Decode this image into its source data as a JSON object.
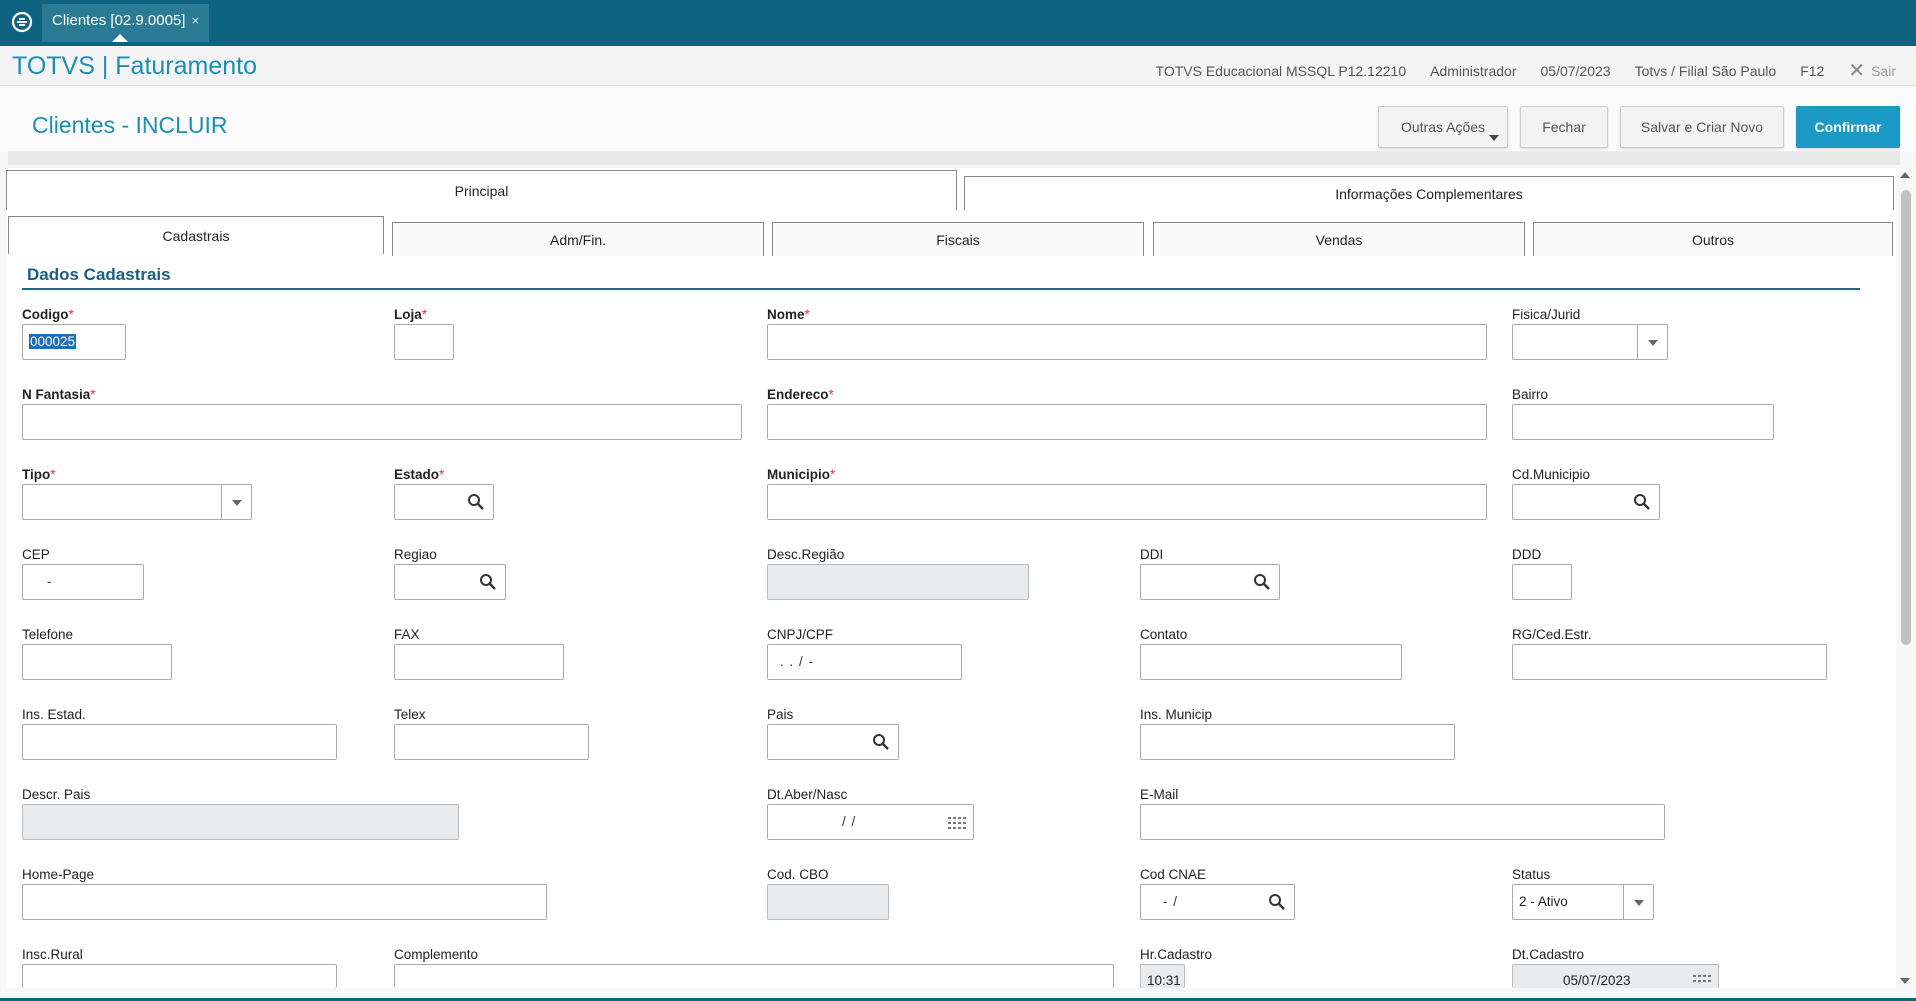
{
  "window": {
    "tab_label": "Clientes [02.9.0005]",
    "tab_close": "×"
  },
  "app": {
    "title": "TOTVS | Faturamento",
    "environment": "TOTVS Educacional MSSQL P12.12210",
    "user": "Administrador",
    "date": "05/07/2023",
    "branch": "Totvs / Filial São Paulo",
    "help_key": "F12",
    "exit_label": "Sair"
  },
  "page": {
    "title": "Clientes - INCLUIR",
    "buttons": {
      "outras_acoes": "Outras Ações",
      "fechar": "Fechar",
      "salvar_criar_novo": "Salvar e Criar Novo",
      "confirmar": "Confirmar"
    }
  },
  "folders": [
    "Principal",
    "Informações Complementares"
  ],
  "subtabs": [
    "Cadastrais",
    "Adm/Fin.",
    "Fiscais",
    "Vendas",
    "Outros"
  ],
  "section_title": "Dados Cadastrais",
  "fields": {
    "codigo": {
      "label": "Codigo",
      "value": "000025"
    },
    "loja": {
      "label": "Loja",
      "value": ""
    },
    "nome": {
      "label": "Nome",
      "value": ""
    },
    "fisica_jurid": {
      "label": "Fisica/Jurid",
      "value": ""
    },
    "n_fantasia": {
      "label": "N Fantasia",
      "value": ""
    },
    "endereco": {
      "label": "Endereco",
      "value": ""
    },
    "bairro": {
      "label": "Bairro",
      "value": ""
    },
    "tipo": {
      "label": "Tipo",
      "value": ""
    },
    "estado": {
      "label": "Estado",
      "value": ""
    },
    "municipio": {
      "label": "Municipio",
      "value": ""
    },
    "cd_municipio": {
      "label": "Cd.Municipio",
      "value": ""
    },
    "cep": {
      "label": "CEP",
      "mask": "-"
    },
    "regiao": {
      "label": "Regiao",
      "value": ""
    },
    "desc_regiao": {
      "label": "Desc.Região",
      "value": ""
    },
    "ddi": {
      "label": "DDI",
      "value": ""
    },
    "ddd": {
      "label": "DDD",
      "value": ""
    },
    "telefone": {
      "label": "Telefone",
      "value": ""
    },
    "fax": {
      "label": "FAX",
      "value": ""
    },
    "cnpj_cpf": {
      "label": "CNPJ/CPF",
      "mask": ". . /  -"
    },
    "contato": {
      "label": "Contato",
      "value": ""
    },
    "rg_ced_estr": {
      "label": "RG/Ced.Estr.",
      "value": ""
    },
    "ins_estad": {
      "label": "Ins. Estad.",
      "value": ""
    },
    "telex": {
      "label": "Telex",
      "value": ""
    },
    "pais": {
      "label": "Pais",
      "value": ""
    },
    "ins_municip": {
      "label": "Ins. Municip",
      "value": ""
    },
    "descr_pais": {
      "label": "Descr. Pais",
      "value": ""
    },
    "dt_aber_nasc": {
      "label": "Dt.Aber/Nasc",
      "mask": "/ /"
    },
    "email": {
      "label": "E-Mail",
      "value": ""
    },
    "home_page": {
      "label": "Home-Page",
      "value": ""
    },
    "cod_cbo": {
      "label": "Cod. CBO",
      "value": ""
    },
    "cod_cnae": {
      "label": "Cod CNAE",
      "mask": "- /"
    },
    "status": {
      "label": "Status",
      "value": "2 - Ativo"
    },
    "insc_rural": {
      "label": "Insc.Rural",
      "value": ""
    },
    "complemento": {
      "label": "Complemento",
      "value": ""
    },
    "hr_cadastro": {
      "label": "Hr.Cadastro",
      "value": "10:31"
    },
    "dt_cadastro": {
      "label": "Dt.Cadastro",
      "value": "05/07/2023"
    }
  },
  "icons": {
    "home": "totvs-home-icon",
    "lookup": "magnifier-icon",
    "calendar": "calendar-icon",
    "dropdown": "chevron-down-icon",
    "close": "close-icon"
  },
  "colors": {
    "topbar": "#0e6480",
    "brand": "#1c8fb4",
    "primary_button": "#1c9ac6",
    "required_star": "#d33333"
  }
}
